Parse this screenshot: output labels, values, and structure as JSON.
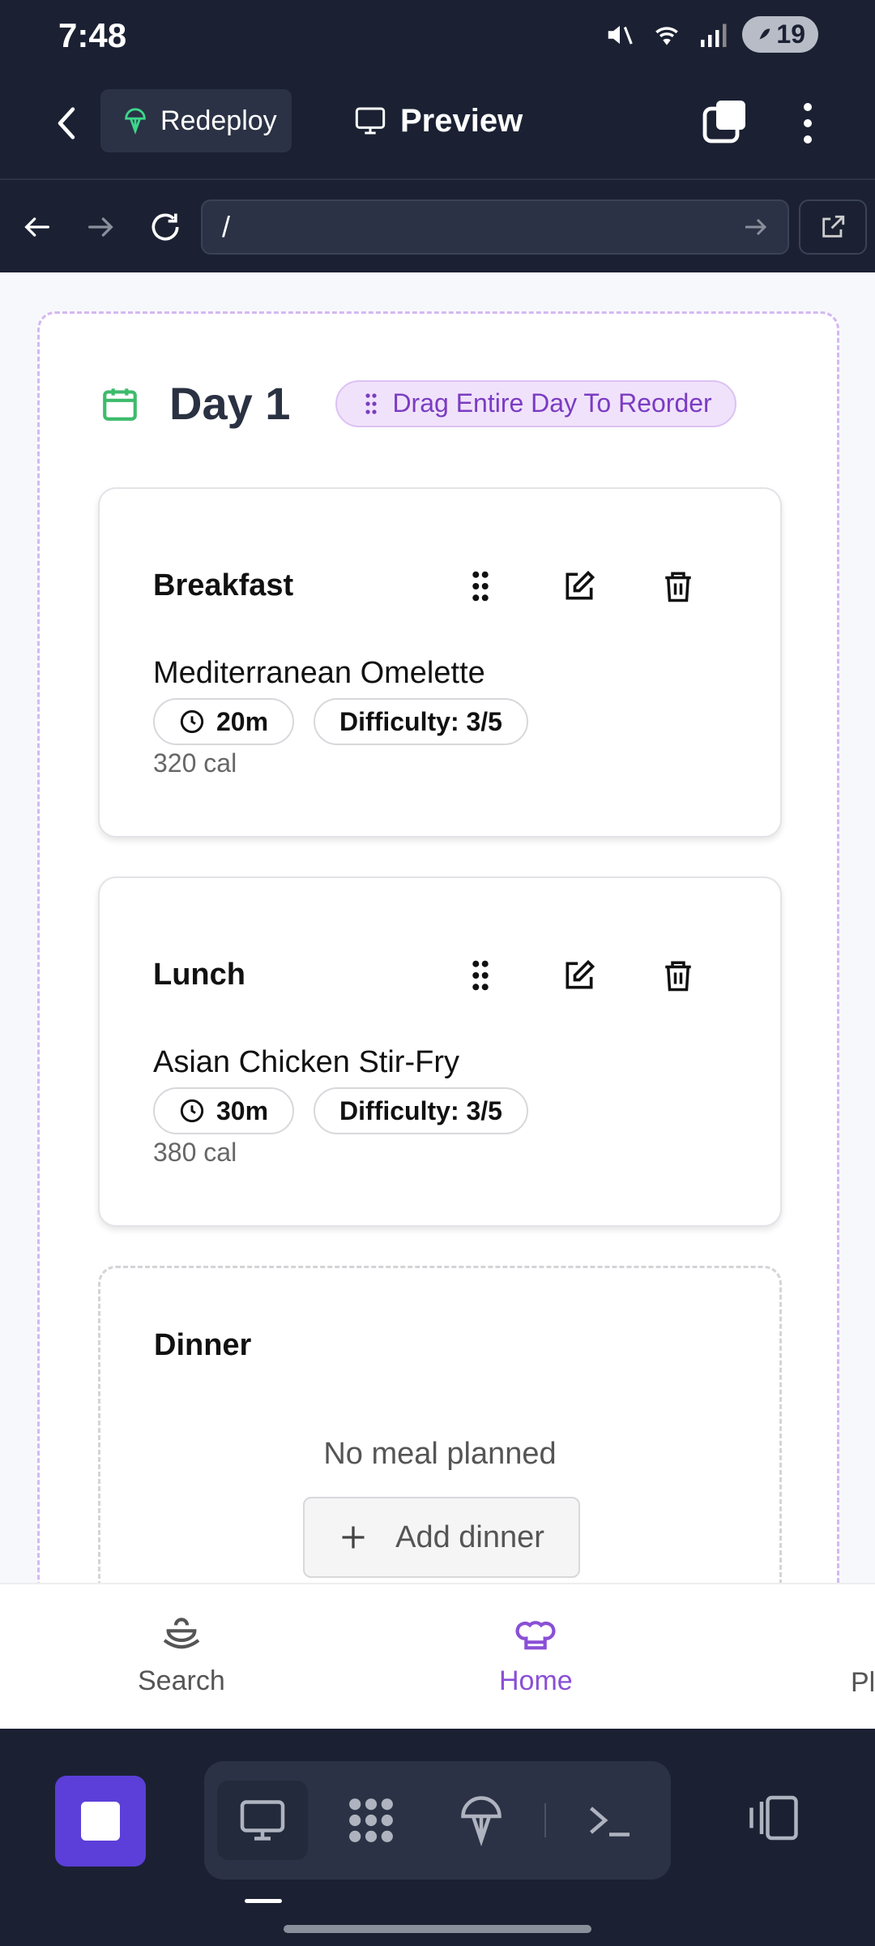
{
  "status": {
    "time": "7:48",
    "battery": "19"
  },
  "app_bar": {
    "redeploy_label": "Redeploy",
    "preview_label": "Preview"
  },
  "url_bar": {
    "url": "/"
  },
  "day": {
    "title": "Day 1",
    "drag_label": "Drag Entire Day To Reorder"
  },
  "meals": [
    {
      "type": "Breakfast",
      "name": "Mediterranean Omelette",
      "time": "20m",
      "difficulty": "Difficulty: 3/5",
      "calories": "320 cal"
    },
    {
      "type": "Lunch",
      "name": "Asian Chicken Stir-Fry",
      "time": "30m",
      "difficulty": "Difficulty: 3/5",
      "calories": "380 cal"
    }
  ],
  "dinner": {
    "type": "Dinner",
    "empty_text": "No meal planned",
    "add_label": "Add dinner"
  },
  "bottom_nav": {
    "search": "Search",
    "home": "Home",
    "partial": "Pl"
  },
  "colors": {
    "accent": "#8a4fd6",
    "dark_bg": "#1b2133",
    "stop_button": "#5b3fd8",
    "calendar_icon": "#3dbb6b"
  },
  "icons": [
    "back-icon",
    "redeploy-icon",
    "monitor-icon",
    "tabs-icon",
    "more-icon",
    "arrow-left-icon",
    "arrow-right-icon",
    "reload-icon",
    "go-arrow-icon",
    "external-link-icon",
    "calendar-icon",
    "grip-icon",
    "drag-handle-icon",
    "edit-icon",
    "trash-icon",
    "clock-icon",
    "plus-icon",
    "search-dish-icon",
    "chef-hat-icon",
    "stop-icon",
    "desktop-icon",
    "pattern-icon",
    "network-icon",
    "terminal-icon",
    "split-view-icon"
  ]
}
